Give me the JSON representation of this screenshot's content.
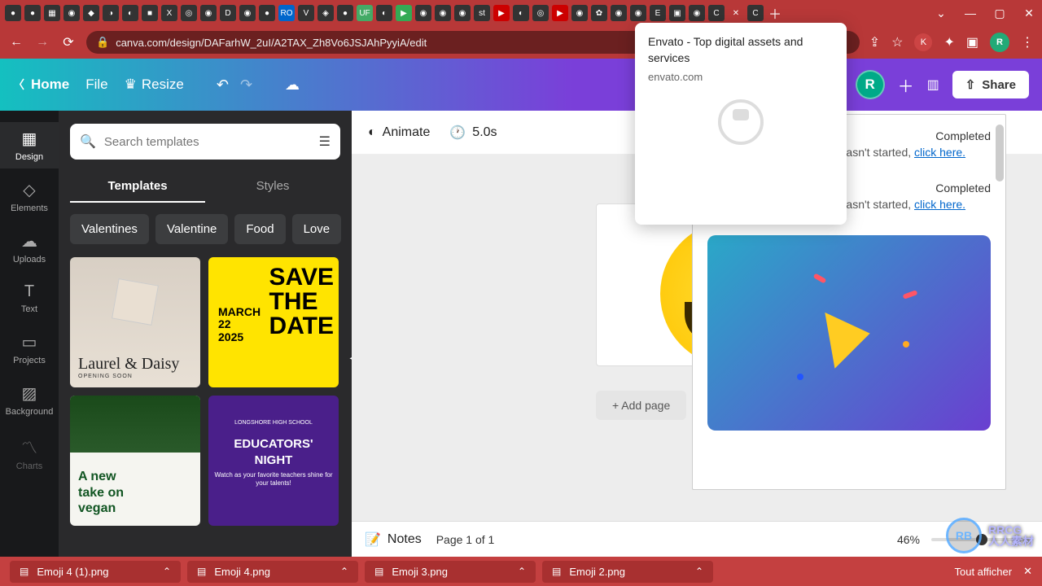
{
  "browser": {
    "url": "canva.com/design/DAFarhW_2uI/A2TAX_Zh8Vo6JSJAhPyyiA/edit",
    "profile_letter": "R",
    "badge_letter": "K"
  },
  "tooltip": {
    "title": "Envato - Top digital assets and services",
    "url": "envato.com"
  },
  "canva": {
    "home": "Home",
    "file": "File",
    "resize": "Resize",
    "share": "Share",
    "avatar_letter": "R"
  },
  "rail": [
    {
      "icon": "▦",
      "label": "Design"
    },
    {
      "icon": "◇",
      "label": "Elements"
    },
    {
      "icon": "☁",
      "label": "Uploads"
    },
    {
      "icon": "T",
      "label": "Text"
    },
    {
      "icon": "▭",
      "label": "Projects"
    },
    {
      "icon": "▨",
      "label": "Background"
    },
    {
      "icon": "〽",
      "label": "Charts"
    }
  ],
  "search": {
    "placeholder": "Search templates"
  },
  "tabs": {
    "templates": "Templates",
    "styles": "Styles"
  },
  "chips": [
    "Valentines",
    "Valentine",
    "Food",
    "Love"
  ],
  "templates": {
    "t1": "Laurel & Daisy",
    "t1_sub": "OPENING SOON",
    "t2_date": "MARCH\n22\n2025",
    "t2_big": "SAVE\nTHE\nDATE",
    "t3": "A new\ntake on\nvegan",
    "t4_top": "LONGSHORE HIGH SCHOOL",
    "t4": "EDUCATORS'\nNIGHT",
    "t4_sub": "Watch as your favorite teachers shine for your talents!"
  },
  "canvas_tools": {
    "animate": "Animate",
    "duration": "5.0s"
  },
  "add_page": "+ Add page",
  "bottom": {
    "notes": "Notes",
    "page": "Page 1 of 1",
    "zoom": "46%"
  },
  "downloads": {
    "status": "Completed",
    "msg_prefix": "If your download hasn't started, ",
    "link": "click here."
  },
  "shelf": [
    "Emoji 4 (1).png",
    "Emoji 4.png",
    "Emoji 3.png",
    "Emoji 2.png"
  ],
  "shelf_all": "Tout afficher",
  "watermark": "RRCG\n人人素材"
}
